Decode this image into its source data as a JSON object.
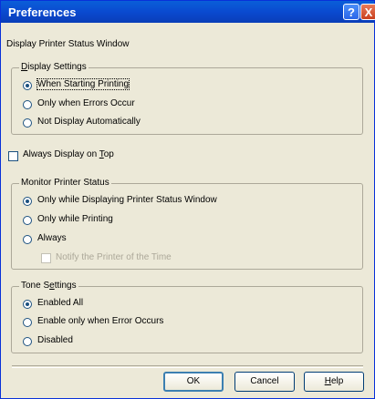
{
  "window": {
    "title": "Preferences"
  },
  "titlebar": {
    "help": "?",
    "close": "X"
  },
  "section_title": "Display Printer Status Window",
  "display_settings": {
    "label": "Display Settings",
    "options": [
      {
        "label": "When Starting Printing",
        "checked": true
      },
      {
        "label": "Only when Errors Occur",
        "checked": false
      },
      {
        "label": "Not Display Automatically",
        "checked": false
      }
    ]
  },
  "always_on_top": {
    "label": "Always Display on Top",
    "checked": false
  },
  "monitor": {
    "label": "Monitor Printer Status",
    "options": [
      {
        "label": "Only while Displaying Printer Status Window",
        "checked": true
      },
      {
        "label": "Only while Printing",
        "checked": false
      },
      {
        "label": "Always",
        "checked": false
      }
    ],
    "notify": {
      "label": "Notify the Printer of the Time",
      "enabled": false
    }
  },
  "tone": {
    "label": "Tone Settings",
    "options": [
      {
        "label": "Enabled All",
        "checked": true
      },
      {
        "label": "Enable only when Error Occurs",
        "checked": false
      },
      {
        "label": "Disabled",
        "checked": false
      }
    ]
  },
  "buttons": {
    "ok": "OK",
    "cancel": "Cancel",
    "help": "Help"
  }
}
